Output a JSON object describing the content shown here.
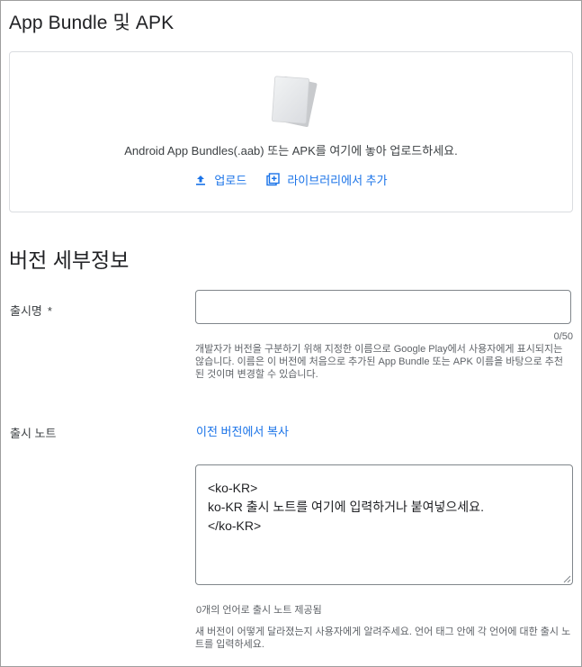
{
  "section": {
    "title": "App Bundle 및 APK"
  },
  "upload": {
    "hint": "Android App Bundles(.aab) 또는 APK를 여기에 놓아 업로드하세요.",
    "upload_label": "업로드",
    "library_label": "라이브러리에서 추가"
  },
  "details": {
    "heading": "버전 세부정보",
    "release_name": {
      "label": "출시명",
      "required_mark": "*",
      "value": "",
      "counter": "0/50",
      "helper": "개발자가 버전을 구분하기 위해 지정한 이름으로 Google Play에서 사용자에게 표시되지는 않습니다. 이름은 이 버전에 처음으로 추가된 App Bundle 또는 APK 이름을 바탕으로 추천된 것이며 변경할 수 있습니다."
    },
    "release_notes": {
      "label": "출시 노트",
      "copy_link": "이전 버전에서 복사",
      "lines": [
        "<ko-KR>",
        "ko-KR 출시 노트를 여기에 입력하거나 붙여넣으세요.",
        "</ko-KR>"
      ],
      "languages_provided": "0개의 언어로 출시 노트 제공됨",
      "helper": "새 버전이 어떻게 달라졌는지 사용자에게 알려주세요. 언어 태그 안에 각 언어에 대한 출시 노트를 입력하세요."
    }
  },
  "colors": {
    "accent": "#1a73e8",
    "border": "#dadce0",
    "text": "#202124",
    "muted": "#5f6368"
  },
  "icons": {
    "upload": "upload-icon",
    "library": "library-add-icon",
    "document": "document-stack-icon"
  }
}
